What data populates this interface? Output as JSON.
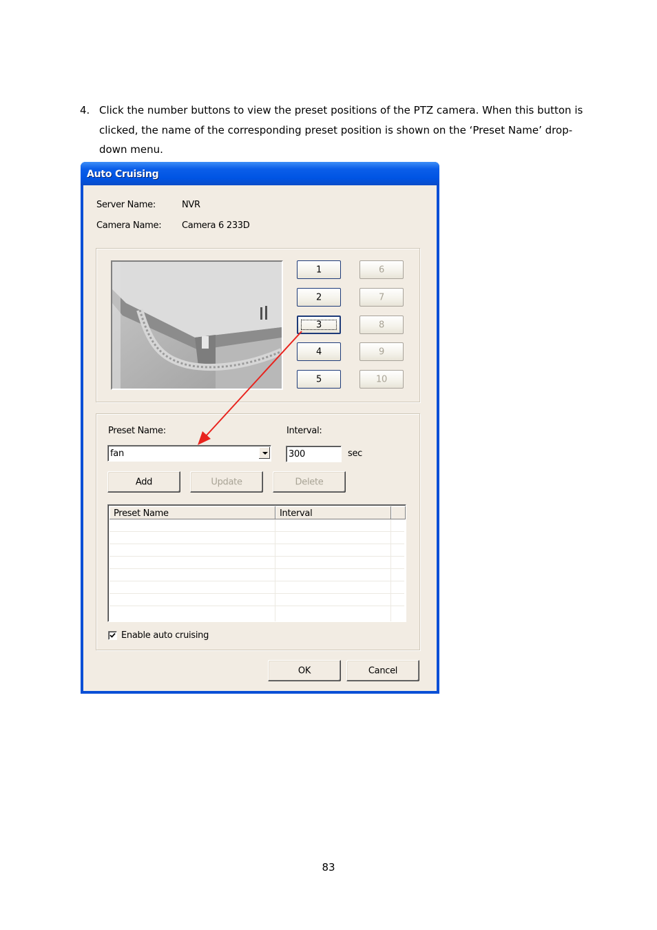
{
  "instructions": {
    "number": "4.",
    "text": "Click the number buttons to view the preset positions of the PTZ camera.   When this button is clicked, the name of the corresponding preset position is shown on the ‘Preset Name’ drop-down menu."
  },
  "dialog": {
    "title": "Auto Cruising",
    "server_name_label": "Server Name:",
    "server_name_value": "NVR",
    "camera_name_label": "Camera Name:",
    "camera_name_value": "Camera 6 233D",
    "preset_buttons": [
      "1",
      "2",
      "3",
      "4",
      "5",
      "6",
      "7",
      "8",
      "9",
      "10"
    ],
    "preset_buttons_enabled": [
      true,
      true,
      true,
      true,
      true,
      false,
      false,
      false,
      false,
      false
    ],
    "focused_preset": "3",
    "preset_name_label": "Preset Name:",
    "preset_name_value": "fan",
    "interval_label": "Interval:",
    "interval_value": "300",
    "interval_unit": "sec",
    "add_label": "Add",
    "update_label": "Update",
    "delete_label": "Delete",
    "list_columns": [
      "Preset Name",
      "Interval"
    ],
    "list_rows": [],
    "enable_auto_cruising_label": "Enable auto cruising",
    "enable_auto_cruising_checked": true,
    "ok_label": "OK",
    "cancel_label": "Cancel"
  },
  "annotation": {
    "arrow_color": "#e8231d"
  },
  "page_number": "83"
}
